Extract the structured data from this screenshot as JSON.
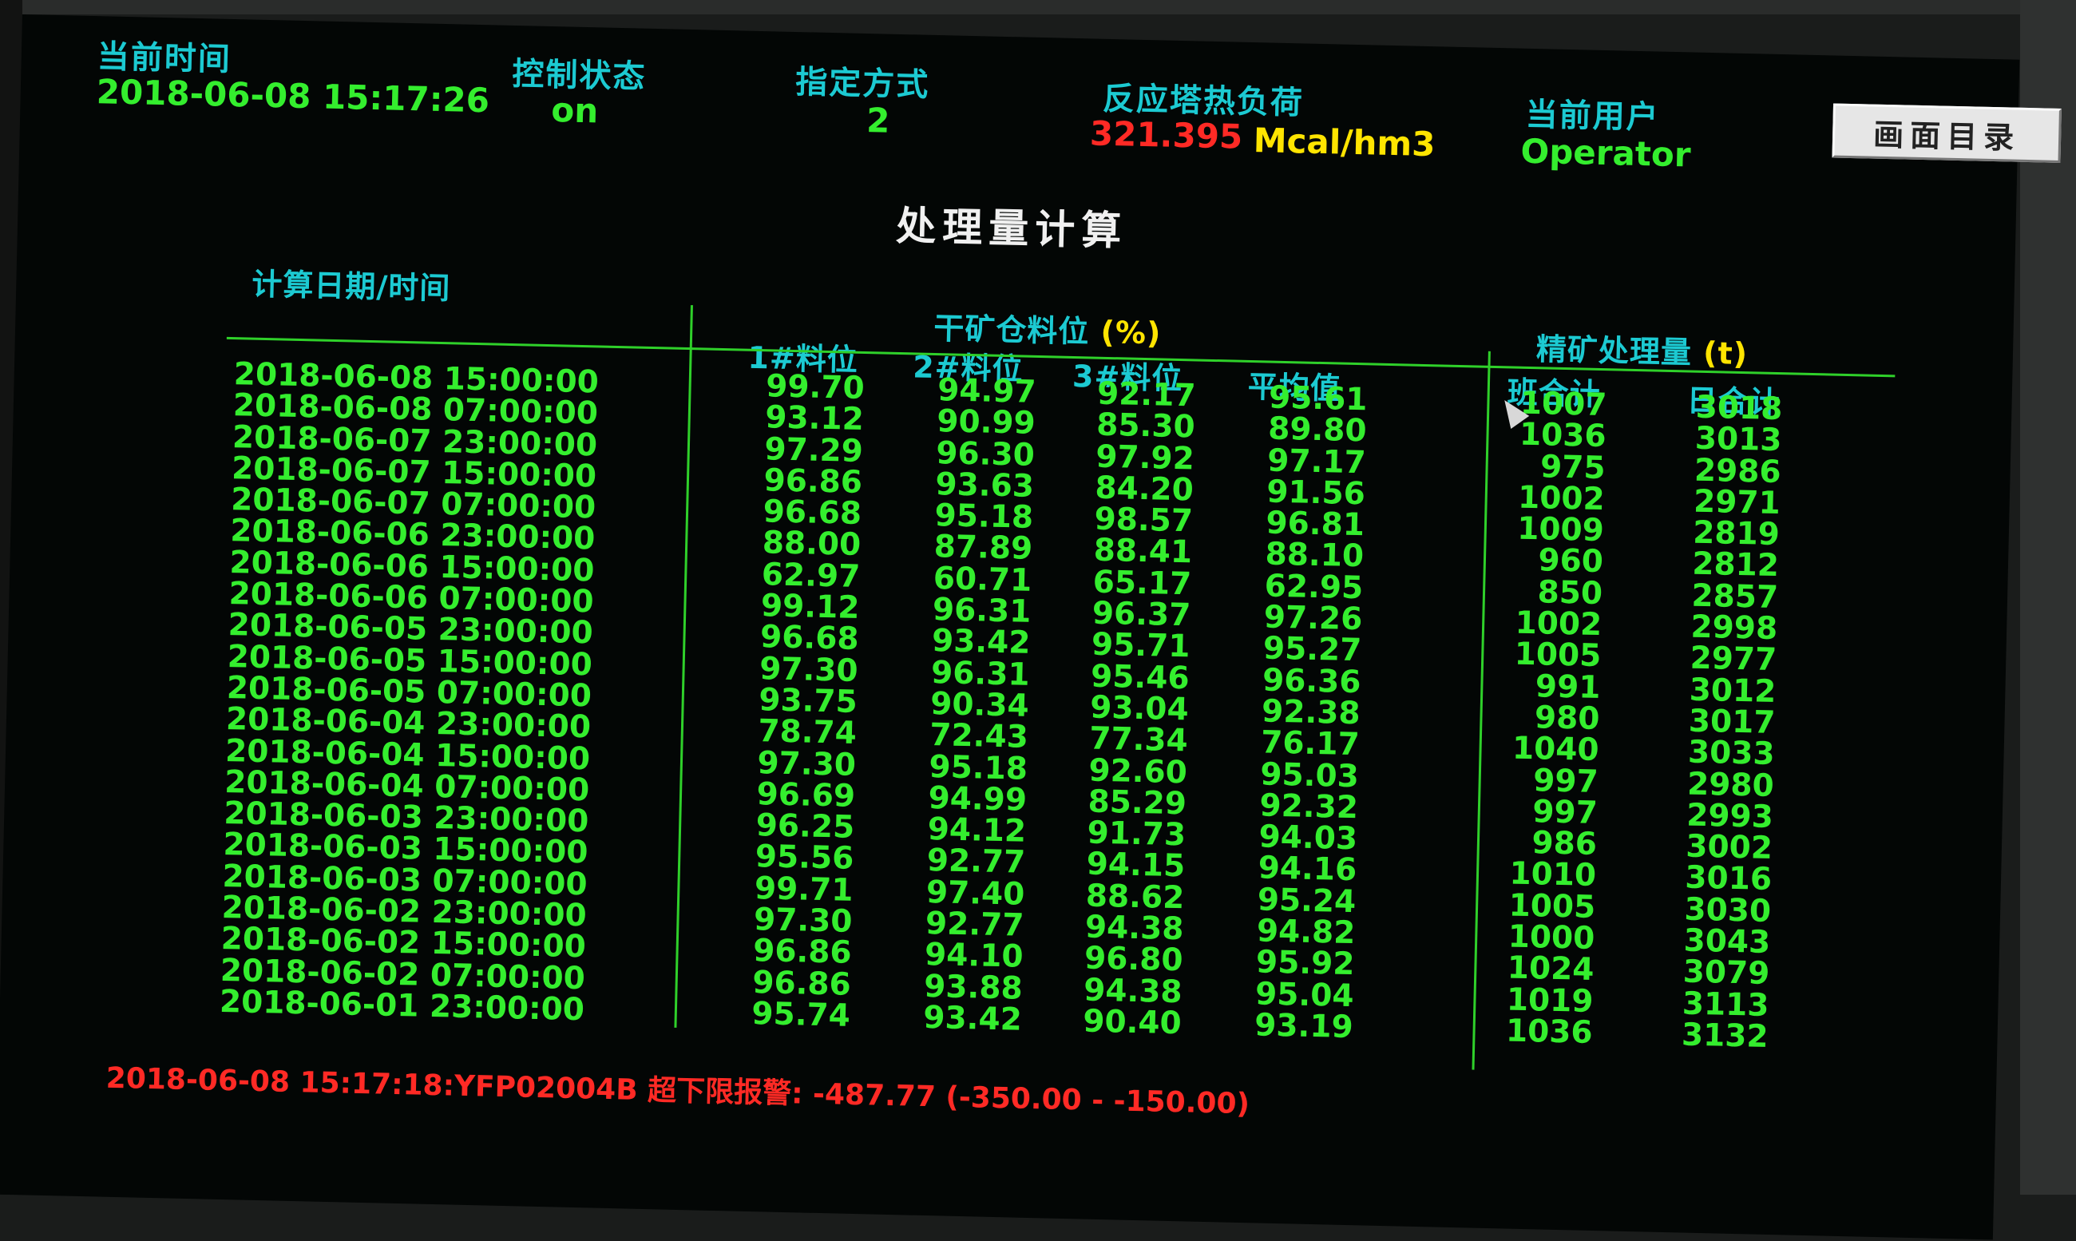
{
  "header": {
    "current_time_label": "当前时间",
    "current_time": "2018-06-08 15:17:26",
    "control_state_label": "控制状态",
    "control_state": "on",
    "mode_label": "指定方式",
    "mode": "2",
    "heat_load_label": "反应塔热负荷",
    "heat_load_value": "321.395",
    "heat_load_unit": "Mcal/hm3",
    "user_label": "当前用户",
    "user": "Operator",
    "menu_button": "画面目录"
  },
  "title": "处理量计算",
  "table": {
    "datetime_header": "计算日期/时间",
    "bin_group_header": "干矿仓料位",
    "bin_group_unit": "(%)",
    "col1": "1#料位",
    "col2": "2#料位",
    "col3": "3#料位",
    "avg": "平均值",
    "concentrate_header": "精矿处理量",
    "concentrate_unit": "(t)",
    "shift_total": "班合计",
    "day_total": "日合计",
    "datetimes": [
      "2018-06-08 15:00:00",
      "2018-06-08 07:00:00",
      "2018-06-07 23:00:00",
      "2018-06-07 15:00:00",
      "2018-06-07 07:00:00",
      "2018-06-06 23:00:00",
      "2018-06-06 15:00:00",
      "2018-06-06 07:00:00",
      "2018-06-05 23:00:00",
      "2018-06-05 15:00:00",
      "2018-06-05 07:00:00",
      "2018-06-04 23:00:00",
      "2018-06-04 15:00:00",
      "2018-06-04 07:00:00",
      "2018-06-03 23:00:00",
      "2018-06-03 15:00:00",
      "2018-06-03 07:00:00",
      "2018-06-02 23:00:00",
      "2018-06-02 15:00:00",
      "2018-06-02 07:00:00",
      "2018-06-01 23:00:00"
    ],
    "bin1": [
      "99.70",
      "93.12",
      "97.29",
      "96.86",
      "96.68",
      "88.00",
      "62.97",
      "99.12",
      "96.68",
      "97.30",
      "93.75",
      "78.74",
      "97.30",
      "96.69",
      "96.25",
      "95.56",
      "99.71",
      "97.30",
      "96.86",
      "96.86",
      "95.74"
    ],
    "bin2": [
      "94.97",
      "90.99",
      "96.30",
      "93.63",
      "95.18",
      "87.89",
      "60.71",
      "96.31",
      "93.42",
      "96.31",
      "90.34",
      "72.43",
      "95.18",
      "94.99",
      "94.12",
      "92.77",
      "97.40",
      "92.77",
      "94.10",
      "93.88",
      "93.42"
    ],
    "bin3": [
      "92.17",
      "85.30",
      "97.92",
      "84.20",
      "98.57",
      "88.41",
      "65.17",
      "96.37",
      "95.71",
      "95.46",
      "93.04",
      "77.34",
      "92.60",
      "85.29",
      "91.73",
      "94.15",
      "88.62",
      "94.38",
      "96.80",
      "94.38",
      "90.40"
    ],
    "average": [
      "95.61",
      "89.80",
      "97.17",
      "91.56",
      "96.81",
      "88.10",
      "62.95",
      "97.26",
      "95.27",
      "96.36",
      "92.38",
      "76.17",
      "95.03",
      "92.32",
      "94.03",
      "94.16",
      "95.24",
      "94.82",
      "95.92",
      "95.04",
      "93.19"
    ],
    "shift": [
      "1007",
      "1036",
      "975",
      "1002",
      "1009",
      "960",
      "850",
      "1002",
      "1005",
      "991",
      "980",
      "1040",
      "997",
      "997",
      "986",
      "1010",
      "1005",
      "1000",
      "1024",
      "1019",
      "1036"
    ],
    "day": [
      "3018",
      "3013",
      "2986",
      "2971",
      "2819",
      "2812",
      "2857",
      "2998",
      "2977",
      "3012",
      "3017",
      "3033",
      "2980",
      "2993",
      "3002",
      "3016",
      "3030",
      "3043",
      "3079",
      "3113",
      "3132"
    ]
  },
  "alarm": "2018-06-08 15:17:18:YFP02004B 超下限报警: -487.77 (-350.00 - -150.00)"
}
